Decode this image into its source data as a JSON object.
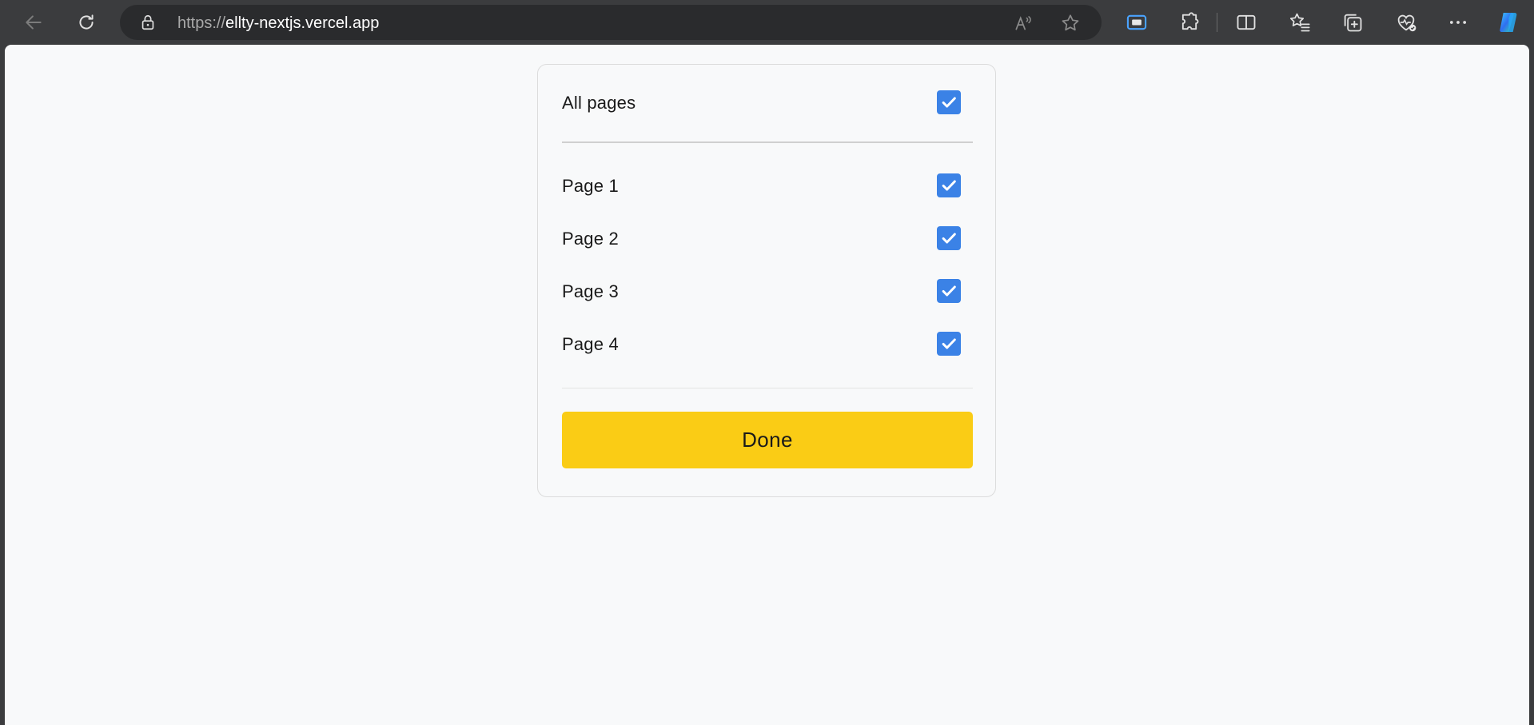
{
  "browser": {
    "url_scheme": "https://",
    "url_host": "ellty-nextjs.vercel.app",
    "icons": {
      "back": "back-arrow-icon",
      "reload": "reload-icon",
      "lock": "lock-icon",
      "read_aloud": "read-aloud-icon",
      "favorite": "star-icon",
      "screen_cast": "cast-icon",
      "extensions": "puzzle-icon",
      "split": "split-screen-icon",
      "favorites": "favorites-icon",
      "collections": "collections-icon",
      "health": "heart-pulse-icon",
      "more": "more-icon",
      "copilot": "copilot-icon"
    }
  },
  "panel": {
    "all_pages_label": "All pages",
    "all_pages_checked": true,
    "pages": [
      {
        "label": "Page 1",
        "checked": true
      },
      {
        "label": "Page 2",
        "checked": true
      },
      {
        "label": "Page 3",
        "checked": true
      },
      {
        "label": "Page 4",
        "checked": true
      }
    ],
    "done_label": "Done"
  },
  "colors": {
    "checkbox": "#3b82e6",
    "button": "#facc15",
    "background": "#f8f9fa"
  }
}
